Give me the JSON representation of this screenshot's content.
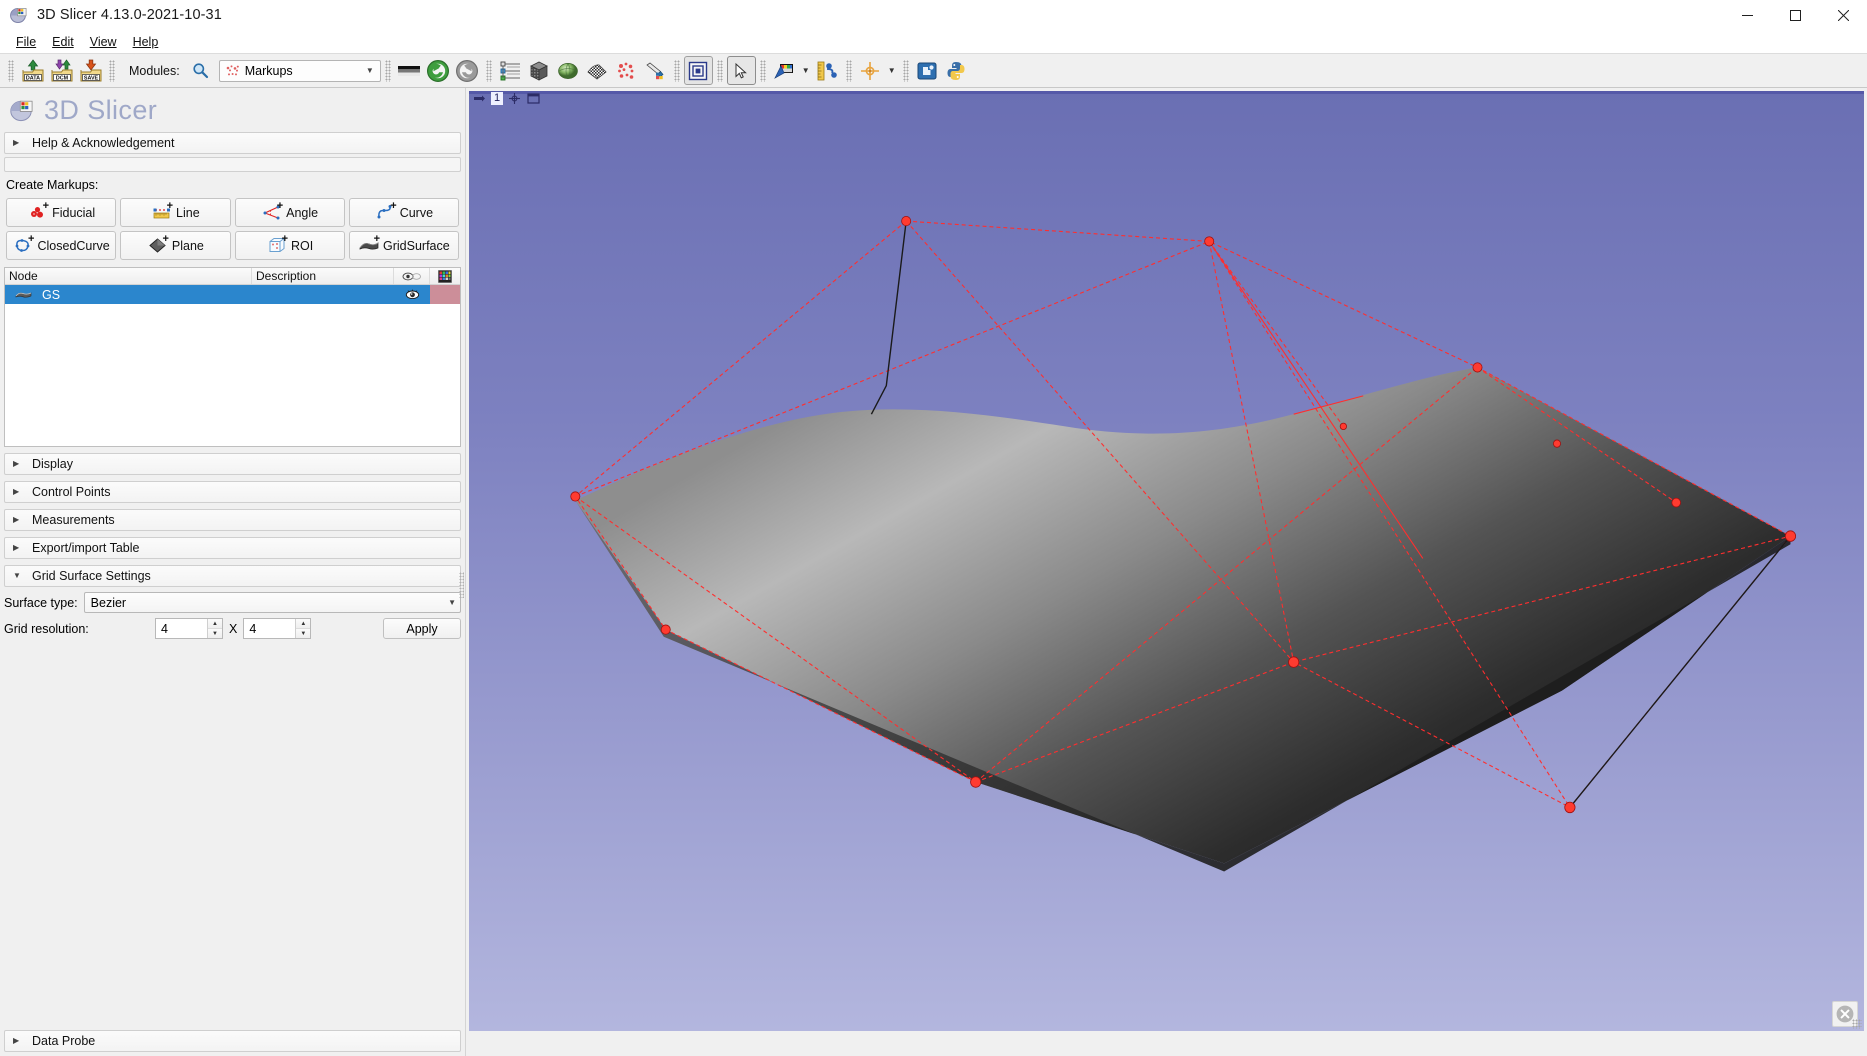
{
  "window": {
    "title": "3D Slicer 4.13.0-2021-10-31",
    "app_icon": "slicer-logo-icon",
    "minimize": "─",
    "maximize": "☐",
    "close": "✕"
  },
  "menu": {
    "items": [
      {
        "label": "File"
      },
      {
        "label": "Edit"
      },
      {
        "label": "View"
      },
      {
        "label": "Help"
      }
    ]
  },
  "toolbar": {
    "modules_label": "Modules:",
    "search_icon": "search-icon",
    "module_selected": "Markups",
    "module_icon": "markups-icon",
    "dropdown_arrow": "▼",
    "buttons": [
      {
        "name": "load-data-button",
        "icon": "load-data-icon",
        "label": "DATA"
      },
      {
        "name": "load-dicom-button",
        "icon": "dicom-icon",
        "label": "DCM"
      },
      {
        "name": "save-data-button",
        "icon": "save-icon",
        "label": "SAVE"
      },
      {
        "name": "module-previous-button",
        "icon": "arrow-back-icon"
      },
      {
        "name": "module-next-button",
        "icon": "arrow-forward-icon"
      },
      {
        "name": "subject-hierarchy-button",
        "icon": "tree-view-icon"
      },
      {
        "name": "volume-rendering-button",
        "icon": "volume-cube-icon"
      },
      {
        "name": "models-button",
        "icon": "green-sphere-icon"
      },
      {
        "name": "segmentations-button",
        "icon": "checker-surface-icon"
      },
      {
        "name": "markups-button",
        "icon": "markups-fiducials-icon"
      },
      {
        "name": "segment-editor-button",
        "icon": "paint-brush-icon"
      },
      {
        "name": "screenshot-button",
        "icon": "screenshot-icon"
      },
      {
        "name": "mouse-mode-button",
        "icon": "cursor-arrow-icon"
      },
      {
        "name": "window-level-button",
        "icon": "color-palette-icon"
      },
      {
        "name": "ruler-button",
        "icon": "ruler-icon"
      },
      {
        "name": "crosshair-button",
        "icon": "crosshair-icon"
      },
      {
        "name": "extension-manager-button",
        "icon": "extensions-icon"
      },
      {
        "name": "python-console-button",
        "icon": "python-icon"
      }
    ]
  },
  "panel": {
    "logo_text": "3D Slicer",
    "help_section": "Help & Acknowledgement",
    "create_markups_label": "Create Markups:",
    "markup_buttons": [
      {
        "label": "Fiducial",
        "icon": "fiducial-icon"
      },
      {
        "label": "Line",
        "icon": "line-icon"
      },
      {
        "label": "Angle",
        "icon": "angle-icon"
      },
      {
        "label": "Curve",
        "icon": "curve-icon"
      },
      {
        "label": "ClosedCurve",
        "icon": "closed-curve-icon"
      },
      {
        "label": "Plane",
        "icon": "plane-icon"
      },
      {
        "label": "ROI",
        "icon": "roi-icon"
      },
      {
        "label": "GridSurface",
        "icon": "grid-surface-icon"
      }
    ],
    "node_table": {
      "columns": [
        "Node",
        "Description",
        "visibility-icon",
        "color-icon"
      ],
      "rows": [
        {
          "name": "GS",
          "description": "",
          "icon": "grid-surface-icon",
          "visibility": "eye-icon",
          "color": "#cc8e99",
          "selected": true
        }
      ]
    },
    "sections": [
      {
        "label": "Display",
        "expanded": false
      },
      {
        "label": "Control Points",
        "expanded": false
      },
      {
        "label": "Measurements",
        "expanded": false
      },
      {
        "label": "Export/import Table",
        "expanded": false
      },
      {
        "label": "Grid Surface Settings",
        "expanded": true
      }
    ],
    "grid_surface_settings": {
      "surface_type_label": "Surface type:",
      "surface_type_value": "Bezier",
      "grid_resolution_label": "Grid resolution:",
      "grid_resolution_x": "4",
      "grid_resolution_sep": "X",
      "grid_resolution_y": "4",
      "apply_label": "Apply"
    },
    "data_probe": "Data Probe"
  },
  "view3d": {
    "view_number": "1",
    "pin_icon": "pin-icon",
    "center_icon": "center-view-icon",
    "maximize_icon": "maximize-view-icon",
    "close_icon": "close-circle-icon",
    "background_top": "#6a6fb3",
    "background_bottom": "#b3b6de",
    "markup_color": "#ff2a2a",
    "surface_light": "#bdbdbd",
    "surface_dark": "#1a1a1a"
  }
}
